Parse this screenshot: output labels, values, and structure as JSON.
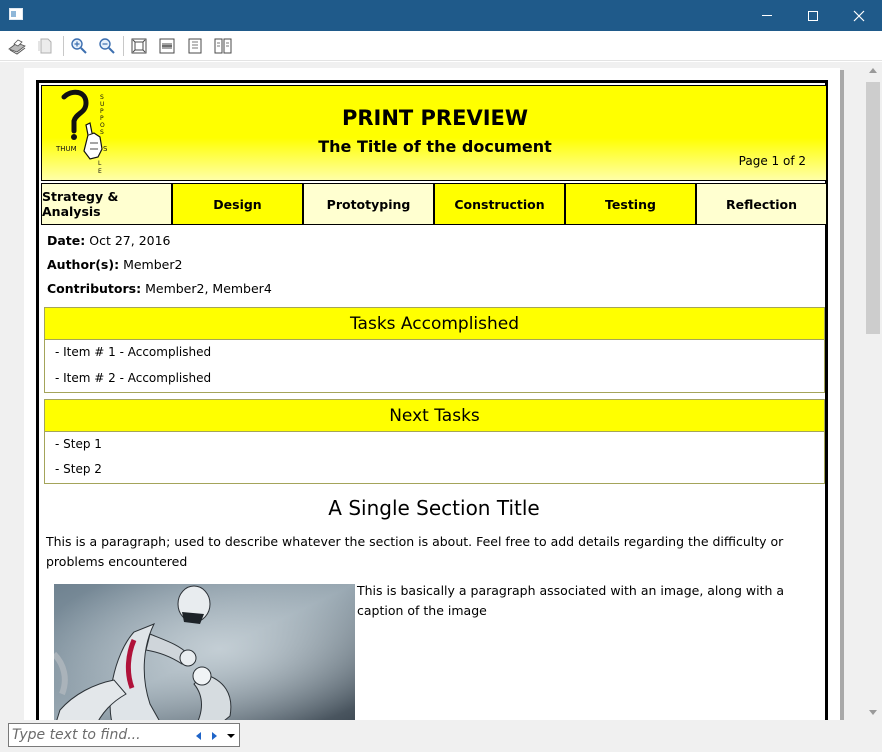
{
  "header": {
    "title": "PRINT PREVIEW",
    "subtitle": "The Title of the document",
    "page_indicator": "Page 1 of 2"
  },
  "phases": [
    {
      "label": "Strategy & Analysis",
      "color": "#ffffd0"
    },
    {
      "label": "Design",
      "color": "#ffff00"
    },
    {
      "label": "Prototyping",
      "color": "#ffffd0"
    },
    {
      "label": "Construction",
      "color": "#ffff00"
    },
    {
      "label": "Testing",
      "color": "#ffff00"
    },
    {
      "label": "Reflection",
      "color": "#ffffd0"
    }
  ],
  "meta": {
    "date_label": "Date:",
    "date_value": "Oct 27, 2016",
    "authors_label": "Author(s):",
    "authors_value": "Member2",
    "contributors_label": "Contributors:",
    "contributors_value": "Member2, Member4"
  },
  "tasks_accomplished": {
    "title": "Tasks Accomplished",
    "items": [
      "-  Item # 1 - Accomplished",
      "-  Item # 2 - Accomplished"
    ]
  },
  "next_tasks": {
    "title": "Next Tasks",
    "items": [
      "-  Step 1",
      "-  Step 2"
    ]
  },
  "section": {
    "title": "A Single Section Title",
    "paragraph": "This is a paragraph; used to describe whatever the section is about.  Feel free to add details regarding the difficulty or problems encountered",
    "image_paragraph": "This is basically a paragraph associated with an image, along with a caption of the image"
  },
  "find": {
    "placeholder": "Type text to find..."
  },
  "toolbar_icons": [
    "print-icon",
    "page-setup-icon",
    "zoom-in-icon",
    "zoom-out-icon",
    "fit-page-icon",
    "fit-width-icon",
    "single-page-icon",
    "two-pages-icon"
  ],
  "colors": {
    "titlebar": "#1f5a8a",
    "header_yellow": "#ffff00",
    "pale_yellow": "#ffffd0"
  }
}
